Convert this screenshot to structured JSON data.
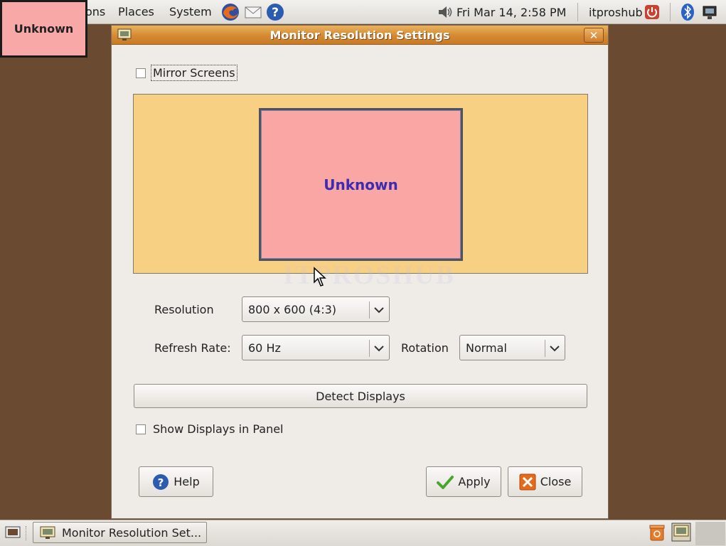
{
  "top_panel": {
    "menu_applications": "ons",
    "menu_places": "Places",
    "menu_system": "System",
    "clock": "Fri Mar 14,  2:58 PM",
    "user": "itproshub"
  },
  "overlay": {
    "label": "Unknown"
  },
  "dialog": {
    "title": "Monitor Resolution Settings",
    "mirror_label": "Mirror Screens",
    "monitor_label": "Unknown",
    "watermark": "ITPROSHUB",
    "resolution_label": "Resolution",
    "resolution_value": "800 x 600 (4:3)",
    "refresh_label": "Refresh Rate:",
    "refresh_value": "60 Hz",
    "rotation_label": "Rotation",
    "rotation_value": "Normal",
    "detect_label": "Detect Displays",
    "show_panel_label": "Show Displays in Panel",
    "help_label": "Help",
    "apply_label": "Apply",
    "close_label": "Close"
  },
  "taskbar": {
    "window_button": "Monitor Resolution Set..."
  },
  "colors": {
    "desktop": "#6a4a31",
    "titlebar": "#d58933",
    "monitor_area": "#f8d083",
    "monitor_fill": "#f9a6a4",
    "monitor_label": "#3c2cb4"
  }
}
